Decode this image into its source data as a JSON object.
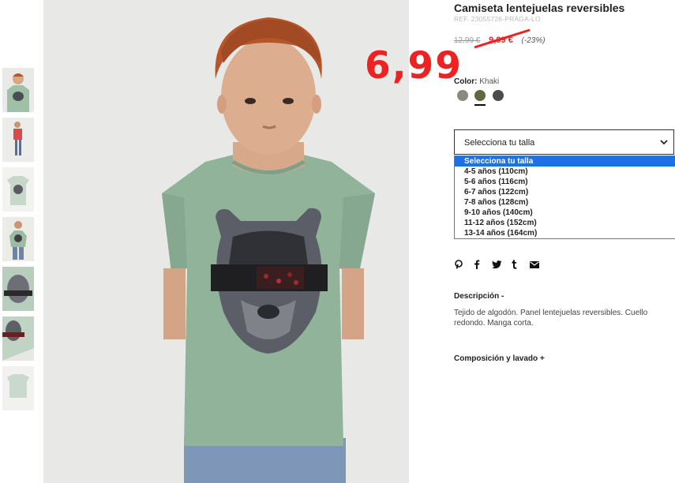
{
  "product": {
    "title": "Camiseta lentejuelas reversibles",
    "ref": "REF. 23055726-PRAGA-LO",
    "old_price": "12,99 €",
    "new_price": "9,09 €",
    "discount": "(-23%)",
    "promo_price": "6,99",
    "promo_color": "#ee2222"
  },
  "color": {
    "label": "Color:",
    "value": "Khaki",
    "swatches": [
      {
        "name": "grey",
        "hex": "#8a8a80"
      },
      {
        "name": "khaki",
        "hex": "#5d6a3d"
      },
      {
        "name": "dark-grey",
        "hex": "#4c4c4c"
      }
    ],
    "selected_index": 1
  },
  "size": {
    "select_label": "Selecciona tu talla",
    "options": [
      "Selecciona tu talla",
      "4-5 años (110cm)",
      "5-6 años (116cm)",
      "6-7 años (122cm)",
      "7-8 años (128cm)",
      "9-10 años (140cm)",
      "11-12 años (152cm)",
      "13-14 años (164cm)"
    ],
    "highlight_color": "#1e6fe8"
  },
  "share": {
    "icons": [
      "pinterest-icon",
      "facebook-icon",
      "twitter-icon",
      "tumblr-icon",
      "email-icon"
    ],
    "glyphs": [
      "𝓹",
      "f",
      "🐦",
      "t",
      "✉"
    ]
  },
  "description": {
    "title": "Descripción -",
    "text": "Tejido de algodón. Panel lentejuelas reversibles. Cuello redondo. Manga corta."
  },
  "composition": {
    "title": "Composición y lavado +"
  }
}
